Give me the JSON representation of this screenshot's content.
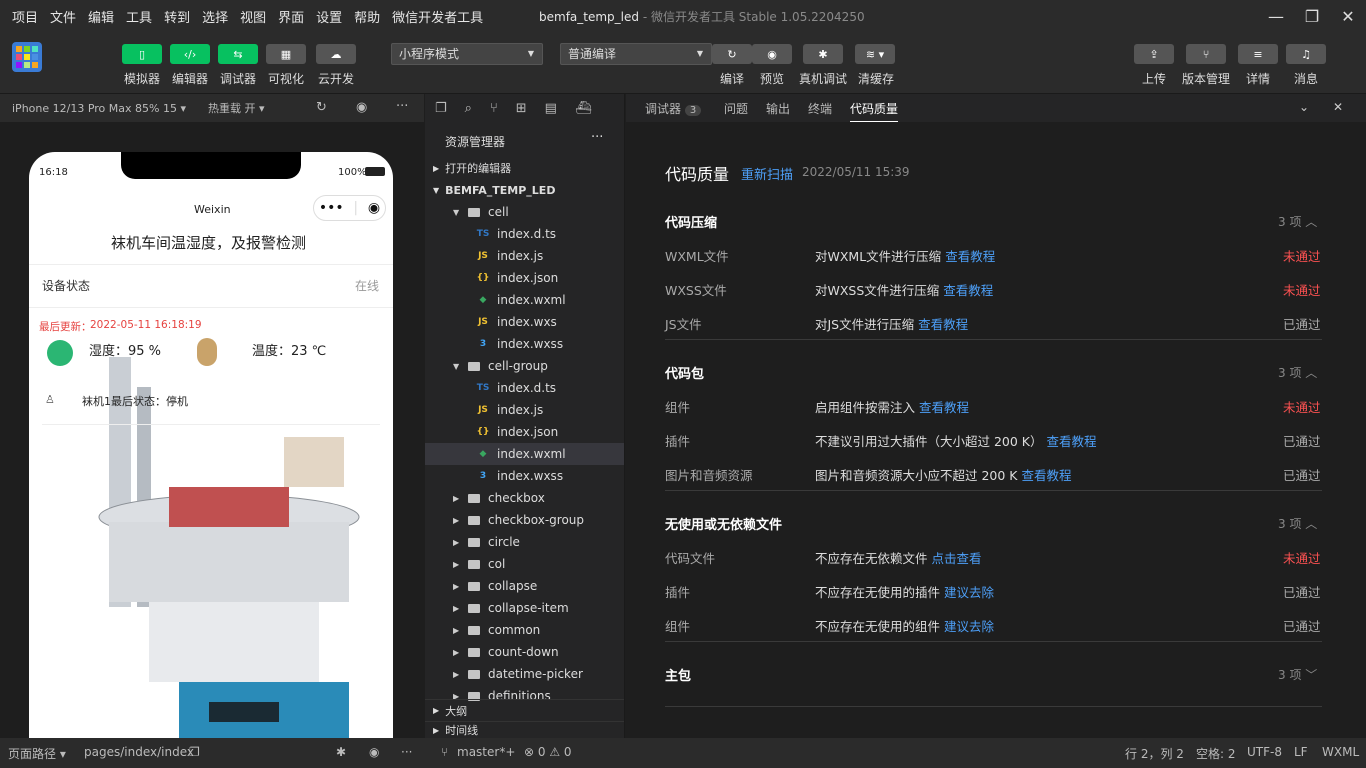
{
  "menu": [
    "项目",
    "文件",
    "编辑",
    "工具",
    "转到",
    "选择",
    "视图",
    "界面",
    "设置",
    "帮助",
    "微信开发者工具"
  ],
  "window": {
    "project": "bemfa_temp_led",
    "sep": " - ",
    "app": "微信开发者工具 Stable 1.05.2204250"
  },
  "toolbar": {
    "left_buttons": [
      {
        "label": "模拟器"
      },
      {
        "label": "编辑器"
      },
      {
        "label": "调试器"
      },
      {
        "label": "可视化"
      },
      {
        "label": "云开发"
      }
    ],
    "mode_select": "小程序模式",
    "compile_select": "普通编译",
    "mid_labels": [
      "编译",
      "预览",
      "真机调试",
      "清缓存"
    ],
    "right_labels": [
      "上传",
      "版本管理",
      "详情",
      "消息"
    ]
  },
  "simulator": {
    "device": "iPhone 12/13 Pro Max 85% 15 ▾",
    "hot_reload": "热重载 开 ▾",
    "phone": {
      "time": "16:18",
      "battery": "100%",
      "nav_title": "Weixin",
      "page_title": "袜机车间温湿度，及报警检测",
      "status_label": "设备状态",
      "status_value": "在线",
      "update_label": "最后更新：",
      "update_time": "2022-05-11 16:18:19",
      "humidity": "湿度：95 %",
      "temperature": "温度：23 ℃",
      "machine_status": "袜机1最后状态：停机"
    }
  },
  "explorer": {
    "title": "资源管理器",
    "more": "···",
    "open_editors": "打开的编辑器",
    "project": "BEMFA_TEMP_LED",
    "rows": [
      {
        "name": "cell",
        "kind": "folder-open",
        "depth": 1
      },
      {
        "name": "index.d.ts",
        "kind": "ts",
        "depth": 2
      },
      {
        "name": "index.js",
        "kind": "js",
        "depth": 2
      },
      {
        "name": "index.json",
        "kind": "json",
        "depth": 2
      },
      {
        "name": "index.wxml",
        "kind": "wxml",
        "depth": 2
      },
      {
        "name": "index.wxs",
        "kind": "js",
        "depth": 2
      },
      {
        "name": "index.wxss",
        "kind": "css",
        "depth": 2
      },
      {
        "name": "cell-group",
        "kind": "folder-open",
        "depth": 1
      },
      {
        "name": "index.d.ts",
        "kind": "ts",
        "depth": 2
      },
      {
        "name": "index.js",
        "kind": "js",
        "depth": 2
      },
      {
        "name": "index.json",
        "kind": "json",
        "depth": 2
      },
      {
        "name": "index.wxml",
        "kind": "wxml",
        "depth": 2,
        "selected": true
      },
      {
        "name": "index.wxss",
        "kind": "css",
        "depth": 2
      },
      {
        "name": "checkbox",
        "kind": "folder",
        "depth": 1
      },
      {
        "name": "checkbox-group",
        "kind": "folder",
        "depth": 1
      },
      {
        "name": "circle",
        "kind": "folder",
        "depth": 1
      },
      {
        "name": "col",
        "kind": "folder",
        "depth": 1
      },
      {
        "name": "collapse",
        "kind": "folder",
        "depth": 1
      },
      {
        "name": "collapse-item",
        "kind": "folder",
        "depth": 1
      },
      {
        "name": "common",
        "kind": "folder",
        "depth": 1
      },
      {
        "name": "count-down",
        "kind": "folder",
        "depth": 1
      },
      {
        "name": "datetime-picker",
        "kind": "folder",
        "depth": 1
      },
      {
        "name": "definitions",
        "kind": "folder",
        "depth": 1
      }
    ],
    "outline": "大纲",
    "timeline": "时间线"
  },
  "panel": {
    "tabs": [
      "调试器",
      "问题",
      "输出",
      "终端",
      "代码质量"
    ],
    "debugger_badge": "3",
    "title": "代码质量",
    "rescan": "重新扫描",
    "scan_time": "2022/05/11 15:39",
    "sections": [
      {
        "title": "代码压缩",
        "count": "3 项",
        "rows": [
          {
            "label": "WXML文件",
            "desc": "对WXML文件进行压缩",
            "link": "查看教程",
            "status": "未通过"
          },
          {
            "label": "WXSS文件",
            "desc": "对WXSS文件进行压缩",
            "link": "查看教程",
            "status": "未通过"
          },
          {
            "label": "JS文件",
            "desc": "对JS文件进行压缩",
            "link": "查看教程",
            "status": "已通过"
          }
        ]
      },
      {
        "title": "代码包",
        "count": "3 项",
        "rows": [
          {
            "label": "组件",
            "desc": "启用组件按需注入",
            "link": "查看教程",
            "status": "未通过"
          },
          {
            "label": "插件",
            "desc": "不建议引用过大插件（大小超过 200 K）",
            "link": "查看教程",
            "status": "已通过"
          },
          {
            "label": "图片和音频资源",
            "desc": "图片和音频资源大小应不超过 200 K",
            "link": "查看教程",
            "status": "已通过"
          }
        ]
      },
      {
        "title": "无使用或无依赖文件",
        "count": "3 项",
        "rows": [
          {
            "label": "代码文件",
            "desc": "不应存在无依赖文件",
            "link": "点击查看",
            "status": "未通过"
          },
          {
            "label": "插件",
            "desc": "不应存在无使用的插件",
            "link": "建议去除",
            "status": "已通过"
          },
          {
            "label": "组件",
            "desc": "不应存在无使用的组件",
            "link": "建议去除",
            "status": "已通过"
          }
        ]
      },
      {
        "title": "主包",
        "count": "3 项",
        "rows": []
      }
    ]
  },
  "status": {
    "page_path_label": "页面路径 ▾",
    "page_path": "pages/index/index",
    "branch": "master*+",
    "problems": "⊗ 0 ⚠ 0",
    "cursor": "行 2，列 2",
    "indent": "空格: 2",
    "encoding": "UTF-8",
    "eol": "LF",
    "lang": "WXML"
  },
  "colors": {
    "green": "#07c160",
    "link": "#4d9ff7",
    "fail": "#fa5151"
  }
}
